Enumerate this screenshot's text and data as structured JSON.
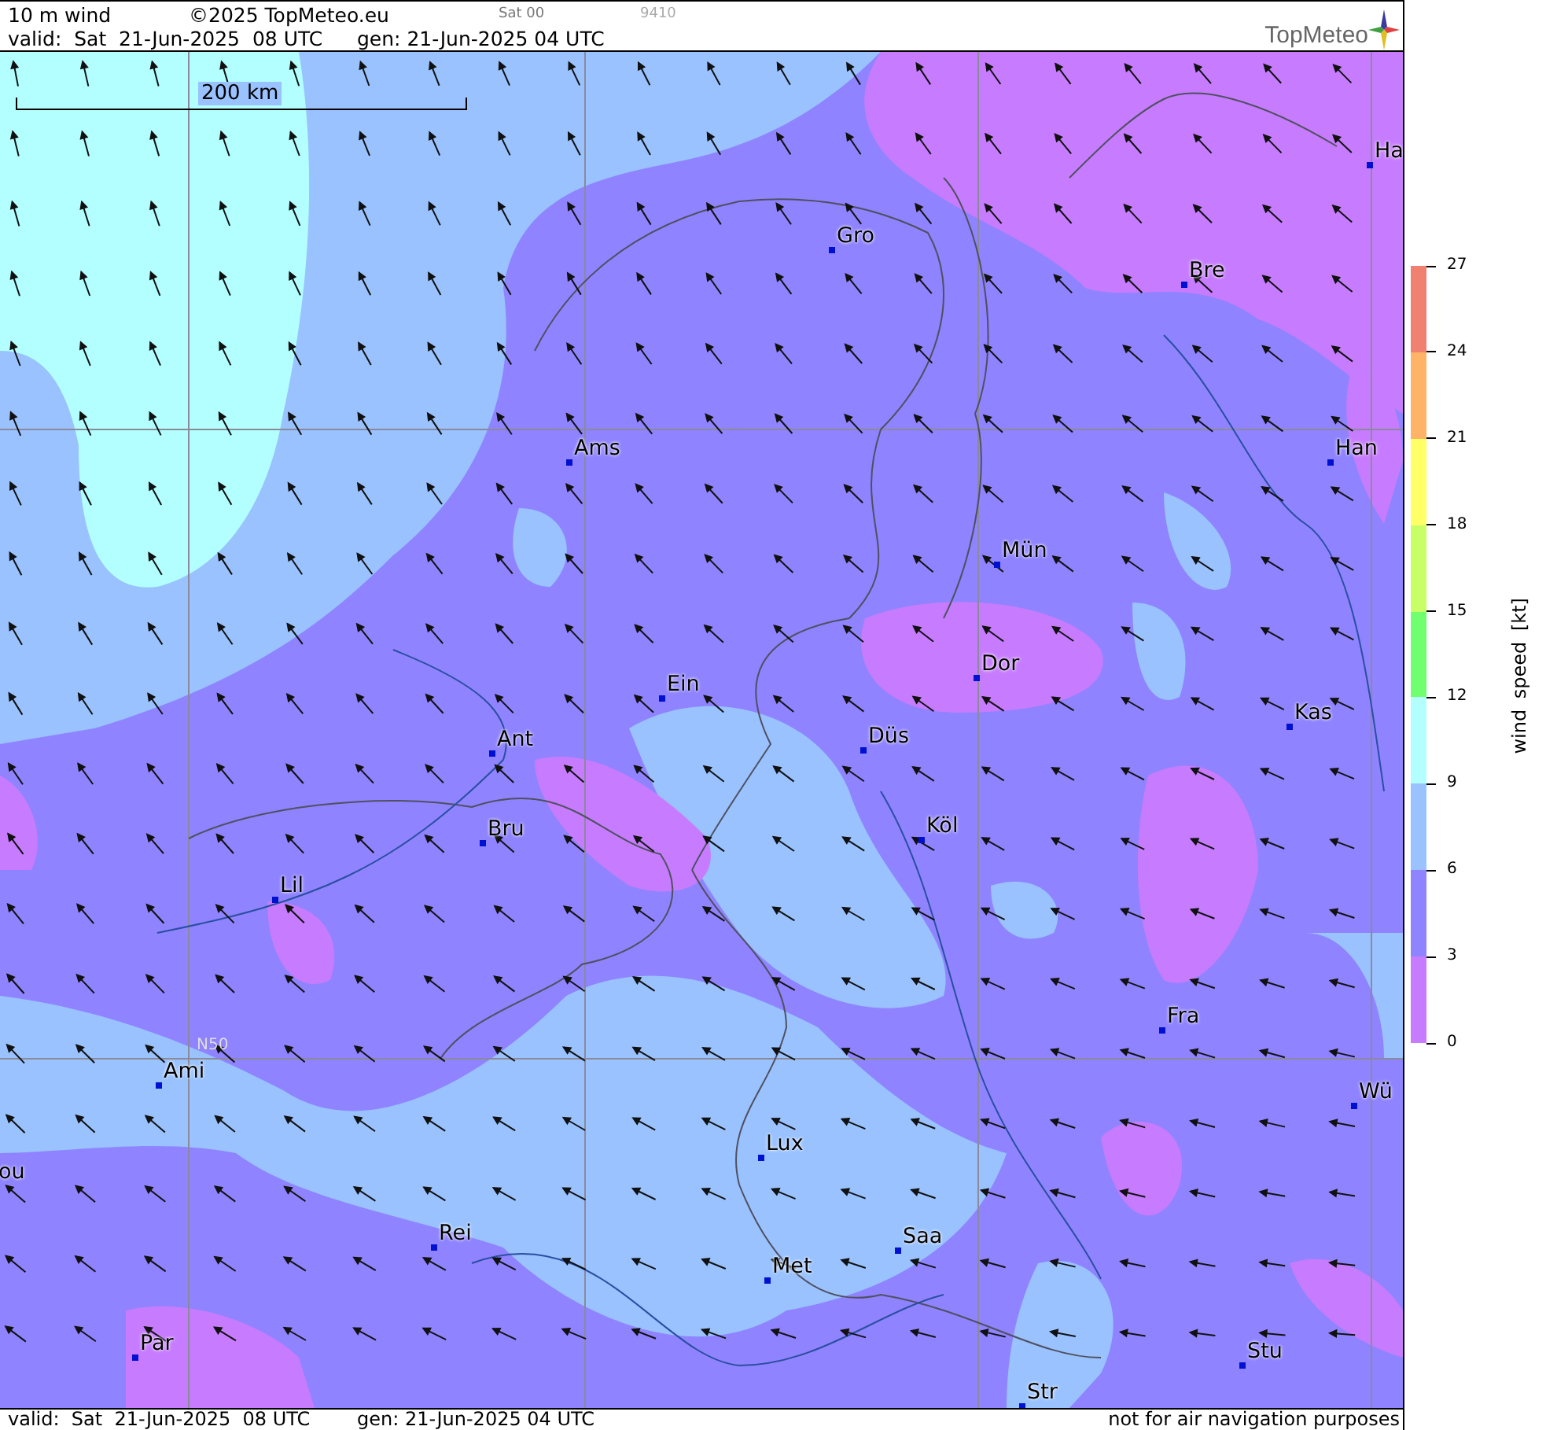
{
  "header": {
    "product": "10 m wind",
    "copyright": "©2025 TopMeteo.eu",
    "run": "Sat 00",
    "code": "9410",
    "valid": "valid:  Sat  21-Jun-2025  08 UTC",
    "generated": "gen: 21-Jun-2025 04 UTC",
    "logo": "TopMeteo"
  },
  "map": {
    "scale": "200 km",
    "grid_label": "N50",
    "cities": [
      {
        "name": "Ha",
        "marker": true
      },
      {
        "name": "Gro",
        "marker": true
      },
      {
        "name": "Bre",
        "marker": true
      },
      {
        "name": "Ams",
        "marker": true
      },
      {
        "name": "Han",
        "marker": true
      },
      {
        "name": "Mün",
        "marker": true
      },
      {
        "name": "Dor",
        "marker": true
      },
      {
        "name": "Ein",
        "marker": true
      },
      {
        "name": "Kas",
        "marker": true
      },
      {
        "name": "Düs",
        "marker": true
      },
      {
        "name": "Ant",
        "marker": true
      },
      {
        "name": "Köl",
        "marker": true
      },
      {
        "name": "Bru",
        "marker": true
      },
      {
        "name": "Lil",
        "marker": true
      },
      {
        "name": "Fra",
        "marker": true
      },
      {
        "name": "Ami",
        "marker": true
      },
      {
        "name": "Wü",
        "marker": true
      },
      {
        "name": "Lux",
        "marker": true
      },
      {
        "name": "ou",
        "marker": false
      },
      {
        "name": "Rei",
        "marker": true
      },
      {
        "name": "Saa",
        "marker": true
      },
      {
        "name": "Met",
        "marker": true
      },
      {
        "name": "Par",
        "marker": true
      },
      {
        "name": "Stu",
        "marker": true
      },
      {
        "name": "Str",
        "marker": true
      }
    ]
  },
  "legend": {
    "title": "wind speed [kt]",
    "ticks": [
      "27",
      "24",
      "21",
      "18",
      "15",
      "12",
      "9",
      "6",
      "3",
      "0"
    ],
    "bands": [
      {
        "color": "#f08070"
      },
      {
        "color": "#ffb366"
      },
      {
        "color": "#ffff66"
      },
      {
        "color": "#c8ff66"
      },
      {
        "color": "#6fff6f"
      },
      {
        "color": "#b3ffff"
      },
      {
        "color": "#99c2ff"
      },
      {
        "color": "#8f83ff"
      },
      {
        "color": "#c77cff"
      }
    ]
  },
  "footer": {
    "valid": "valid:  Sat  21-Jun-2025  08 UTC",
    "generated": "gen: 21-Jun-2025 04 UTC",
    "notice": "not for air navigation purposes"
  }
}
